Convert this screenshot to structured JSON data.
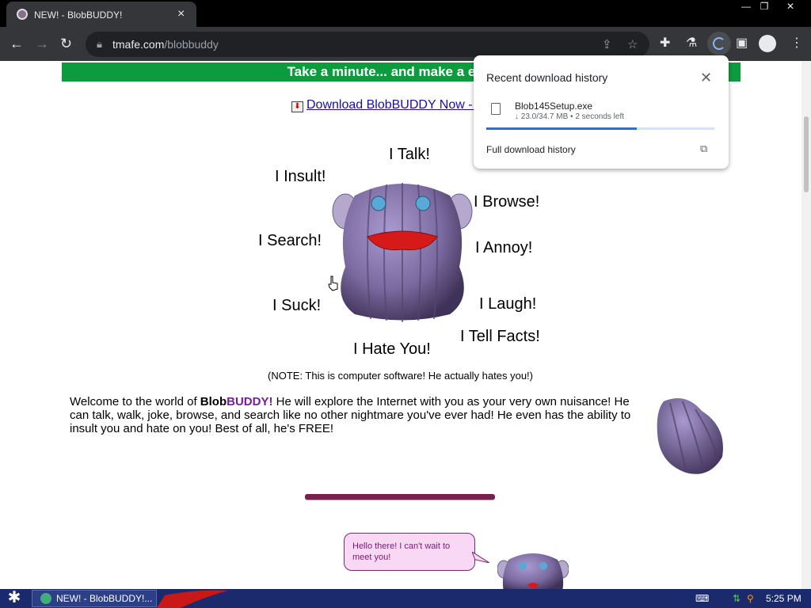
{
  "browser": {
    "tab_title": "NEW! - BlobBUDDY!",
    "tab_close": "×",
    "window_controls": [
      "—",
      "❐",
      "✕"
    ],
    "url_host": "tmafe.com",
    "url_path": "/blobbuddy"
  },
  "page": {
    "banner": "Take a minute... and make a enemy!",
    "download_link": "Download BlobBUDDY Now - FREE!",
    "blob_words": [
      "I Talk!",
      "I Insult!",
      "I Browse!",
      "I Search!",
      "I Annoy!",
      "I Suck!",
      "I Laugh!",
      "I Tell Facts!",
      "I Hate You!"
    ],
    "note": "(NOTE: This is computer software! He actually hates you!)",
    "welcome_prefix": "Welcome to the world of ",
    "brand_blob": "Blob",
    "brand_buddy": "BUDDY!",
    "welcome_rest": " He will explore the Internet with you as your very own nuisance! He can talk, walk, joke, browse, and search like no other nightmare you've ever had!  He even has the ability to insult you and hate on you! Best of all, he's FREE!",
    "speech_bubble": "Hello there! I can't wait to meet you!"
  },
  "download_popup": {
    "title": "Recent download history",
    "close": "✕",
    "file_name": "Blob145Setup.exe",
    "status": "↓ 23.0/34.7 MB • 2 seconds left",
    "progress_fraction": 0.66,
    "full_history": "Full download history",
    "external_icon": "⧉"
  },
  "taskbar": {
    "start_icon": "✱",
    "task_label": "NEW! - BlobBUDDY!...",
    "clock": "5:25 PM"
  },
  "colors": {
    "banner": "#0c9c3e",
    "brand_purple": "#7a1a9e",
    "taskbar": "#1a2a6c",
    "progress": "#1a73e8"
  }
}
